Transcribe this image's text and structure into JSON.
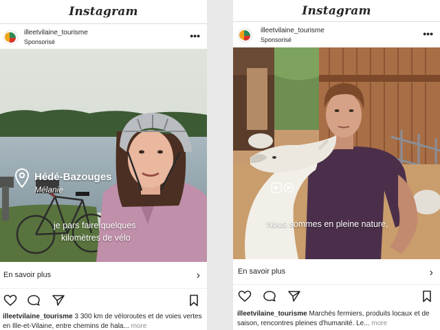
{
  "left_post": {
    "header_logo": "Instagram",
    "username": "illeetvilaine_tourisme",
    "sponsored_label": "Sponsorisé",
    "location_title": "Hédé-Bazouges",
    "person_name": "Mélanie",
    "subtitle_line1": "je pars faire quelques",
    "subtitle_line2": "kilomètres de vélo",
    "cta_label": "En savoir plus",
    "caption_user": "illeetvilaine_tourisme",
    "caption_text": " 3 300 km de véloroutes et de voies vertes en Ille-et-Vilaine, entre chemins de hala... ",
    "caption_more": "more"
  },
  "right_post": {
    "header_logo": "Instagram",
    "username": "illeetvilaine_tourisme",
    "sponsored_label": "Sponsorisé",
    "subtitle": "Nous sommes en pleine nature,",
    "cta_label": "En savoir plus",
    "caption_user": "illeetvilaine_tourisme",
    "caption_text": " Marchés fermiers, produits locaux et de saison, rencontres pleines d'humanité. Le... ",
    "caption_more": "more"
  },
  "colors": {
    "background": "#e9e9e9",
    "text": "#262626",
    "muted": "#8e8e8e",
    "divider": "#dbdbdb"
  },
  "icons": [
    "more-dots-icon",
    "location-pin-icon",
    "heart-icon",
    "comment-icon",
    "share-icon",
    "bookmark-icon",
    "chevron-right-icon",
    "sound-icon"
  ]
}
